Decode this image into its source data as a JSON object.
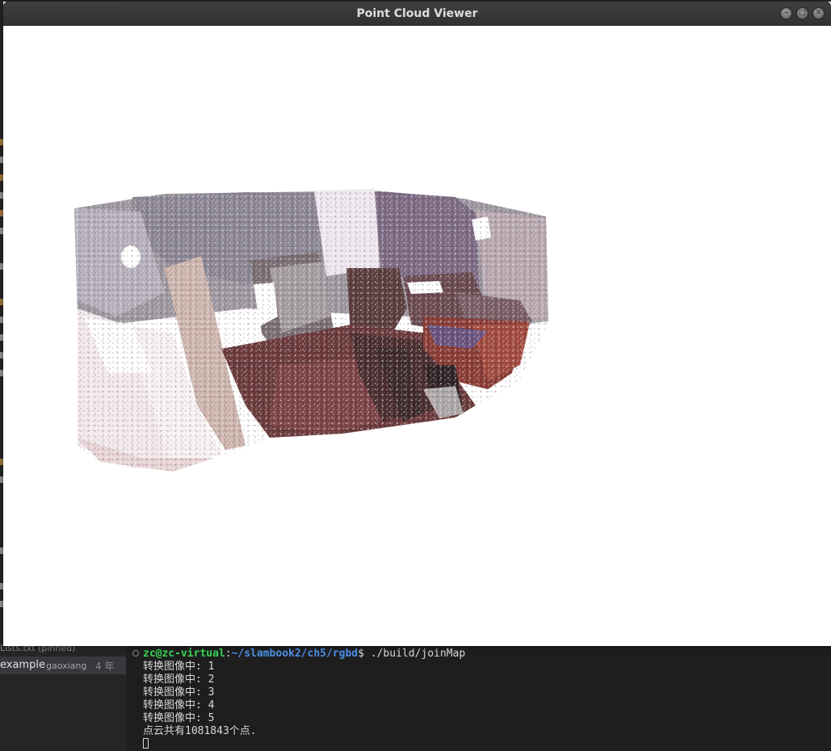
{
  "window": {
    "title": "Point Cloud Viewer",
    "controls": {
      "minimize_icon": "–",
      "maximize_icon": "□",
      "close_icon": "✕"
    }
  },
  "sidebar": {
    "pinned_file": "Lists.txt (pinned)",
    "git_entry": {
      "name": "example",
      "author": "gaoxiang",
      "age": "4 年"
    }
  },
  "terminal": {
    "prompt_user": "zc@zc-virtual",
    "prompt_sep": ":",
    "prompt_path": "~/slambook2/ch5/rgbd",
    "prompt_end": "$ ",
    "command": "./build/joinMap",
    "output": [
      "转换图像中: 1",
      "转换图像中: 2",
      "转换图像中: 3",
      "转换图像中: 4",
      "转换图像中: 5",
      "点云共有1081843个点."
    ]
  },
  "colors": {
    "prompt_user": "#39d353",
    "prompt_path": "#4c8fe6",
    "terminal_bg": "#1e1e1e",
    "titlebar": "#363636"
  }
}
